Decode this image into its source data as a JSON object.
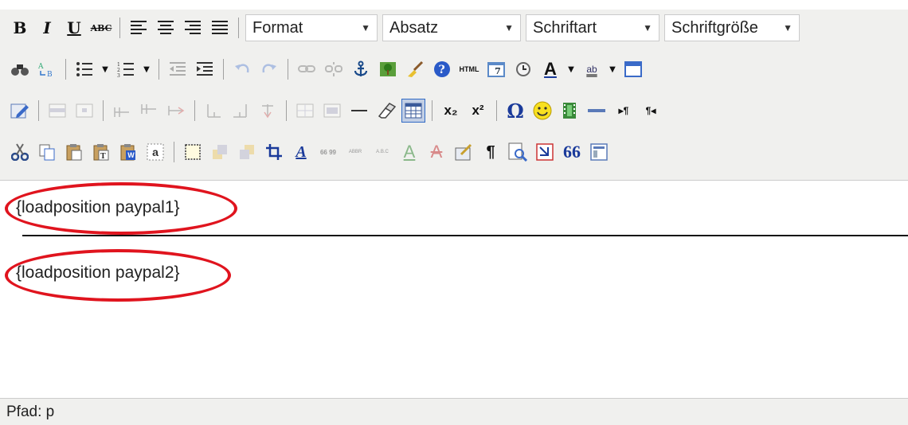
{
  "toolbar": {
    "row1": {
      "bold": "B",
      "italic": "I",
      "underline": "U",
      "strikethrough": "ABC",
      "selects": [
        {
          "label": "Format"
        },
        {
          "label": "Absatz"
        },
        {
          "label": "Schriftart"
        },
        {
          "label": "Schriftgröße"
        }
      ]
    },
    "row2": {
      "html_label": "HTML",
      "date_label": "7",
      "text_color_label": "A",
      "highlight_label": "ab"
    },
    "row3": {
      "subscript": "x₂",
      "superscript": "x²",
      "omega": "Ω",
      "ltr": "▸¶",
      "rtl": "¶◂"
    },
    "row4": {
      "word_label": "W",
      "text_label": "a",
      "style_label": "A",
      "cite_label": "66 99",
      "abbr_label": "ABBR",
      "acronym_label": "A.B.C",
      "ins_label": "A",
      "del_label": "A",
      "para_label": "¶",
      "quote_label": "66"
    }
  },
  "content": {
    "para1": "{loadposition paypal1}",
    "para2": "{loadposition paypal2}"
  },
  "annotation_color": "#e0141e",
  "status": {
    "path": "Pfad: p"
  }
}
